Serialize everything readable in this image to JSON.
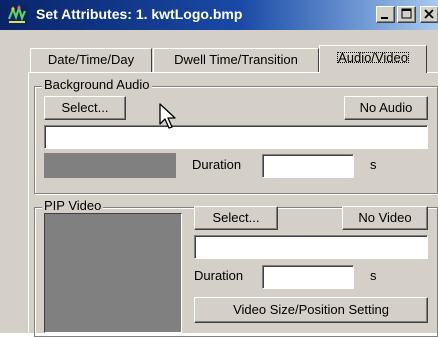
{
  "window": {
    "title": "Set Attributes: 1. kwtLogo.bmp"
  },
  "tabs": [
    {
      "label": "Date/Time/Day",
      "active": false
    },
    {
      "label": "Dwell Time/Transition",
      "active": false
    },
    {
      "label": "Audio/Video",
      "active": true
    }
  ],
  "background_audio": {
    "group_label": "Background Audio",
    "select_label": "Select...",
    "no_audio_label": "No Audio",
    "file_value": "",
    "duration_label": "Duration",
    "duration_value": "",
    "duration_unit": "s"
  },
  "pip_video": {
    "group_label": "PIP Video",
    "select_label": "Select...",
    "no_video_label": "No Video",
    "file_value": "",
    "duration_label": "Duration",
    "duration_value": "",
    "duration_unit": "s",
    "size_position_label": "Video Size/Position Setting"
  },
  "colors": {
    "titlebar_start": "#0a246a",
    "titlebar_end": "#a6caf0",
    "face": "#d4d0c8",
    "preview": "#808080"
  }
}
